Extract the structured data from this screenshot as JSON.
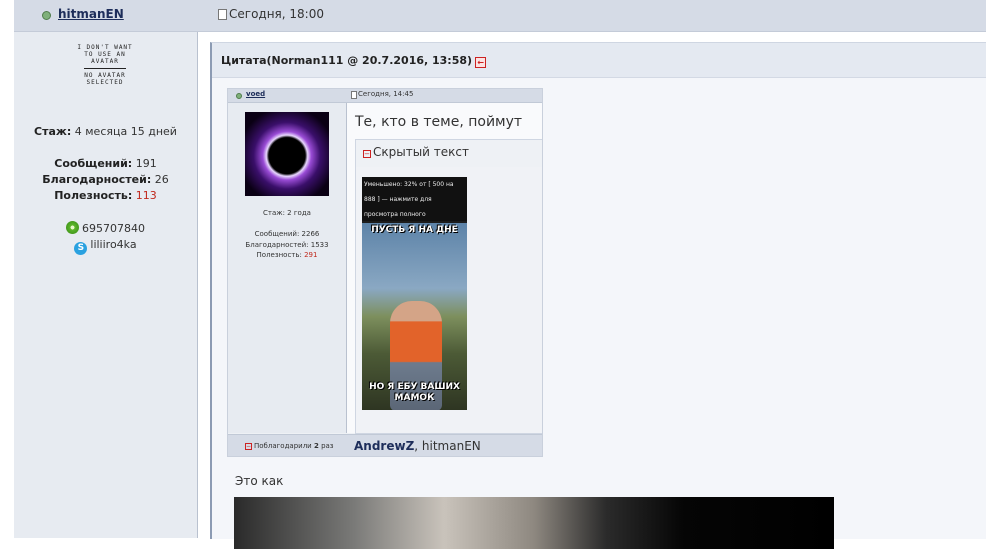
{
  "post": {
    "author": "hitmanEN",
    "date": "Сегодня, 18:00"
  },
  "sidebar": {
    "avatar_text": [
      "I DON'T WANT",
      "TO USE AN",
      "AVATAR",
      "NO AVATAR",
      "SELECTED"
    ],
    "tenure_label": "Стаж:",
    "tenure_value": "4 месяца 15 дней",
    "messages_label": "Сообщений:",
    "messages_value": "191",
    "thanks_label": "Благодарностей:",
    "thanks_value": "26",
    "usefulness_label": "Полезность:",
    "usefulness_value": "113",
    "icq": "695707840",
    "skype": "liliiro4ka"
  },
  "quote": {
    "title": "Цитата(Norman111 @ 20.7.2016, 13:58)"
  },
  "embed": {
    "author": "voed",
    "date": "Сегодня, 14:45",
    "text": "Те, кто в теме, поймут",
    "hidden_label": "Скрытый текст",
    "resize_notice": "Уменьшено: 32% от [ 500 на 888 ] — нажмите для просмотра полного изображения",
    "meme_top": "ПУСТЬ Я НА ДНЕ",
    "meme_bottom": "НО Я ЕБУ ВАШИХ МАМОК",
    "tenure": "Стаж: 2 года",
    "messages": "Сообщений: 2266",
    "thanks": "Благодарностей: 1533",
    "usefulness_label": "Полезность:",
    "usefulness_value": "291",
    "thanked_prefix": "Поблагодарили",
    "thanked_count": "2",
    "thanked_suffix": "раз",
    "thankers_bold": "AndrewZ",
    "thankers_rest": ", hitmanEN"
  },
  "body_text": "Это как",
  "colors": {
    "accent_red": "#c0281c",
    "header_bg": "#d5dbe6",
    "sidebar_bg": "#e7ebf1"
  }
}
